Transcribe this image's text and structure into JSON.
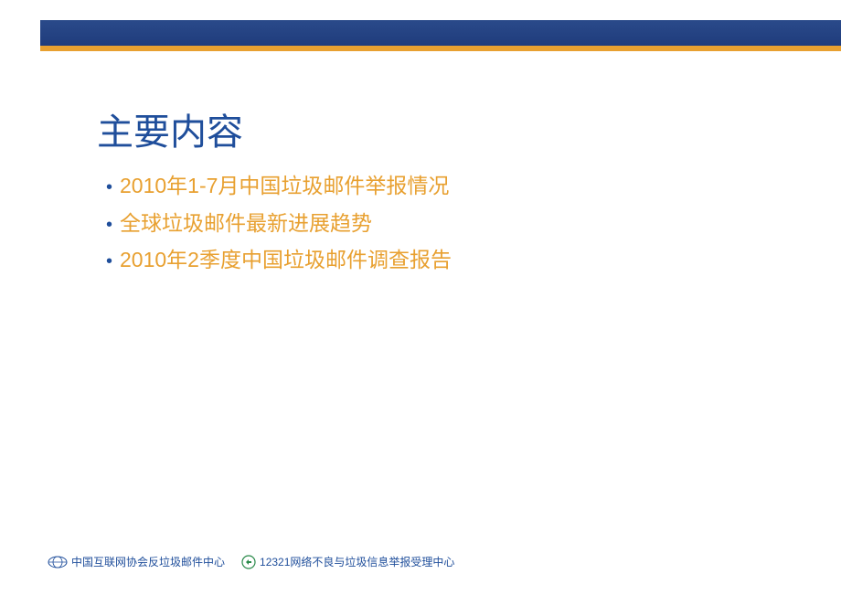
{
  "slide": {
    "title": "主要内容",
    "bullets": [
      "2010年1-7月中国垃圾邮件举报情况",
      "全球垃圾邮件最新进展趋势",
      "2010年2季度中国垃圾邮件调查报告"
    ]
  },
  "footer": {
    "org1": "中国互联网协会反垃圾邮件中心",
    "org2": "12321网络不良与垃圾信息举报受理中心"
  },
  "colors": {
    "title": "#1f4e9b",
    "bullet": "#e8a030",
    "bar": "#1e3a7a"
  }
}
